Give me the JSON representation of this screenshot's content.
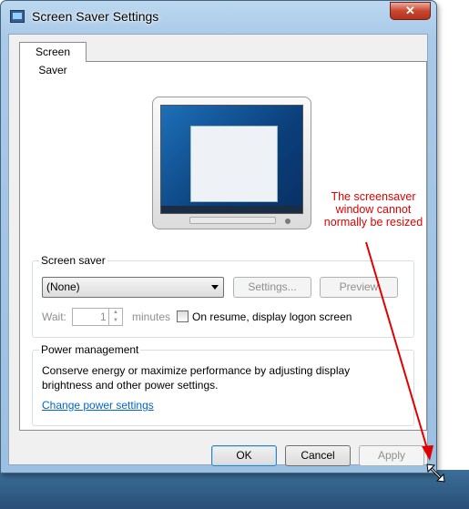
{
  "window": {
    "title": "Screen Saver Settings",
    "close_label": "✕"
  },
  "tabs": [
    {
      "label": "Screen Saver"
    }
  ],
  "screen_saver": {
    "group_label": "Screen saver",
    "selected": "(None)",
    "settings_label": "Settings...",
    "preview_label": "Preview",
    "wait_label": "Wait:",
    "wait_value": "1",
    "minutes_label": "minutes",
    "resume_label": "On resume, display logon screen",
    "resume_checked": false
  },
  "power": {
    "group_label": "Power management",
    "description": "Conserve energy or maximize performance by adjusting display brightness and other power settings.",
    "link_label": "Change power settings"
  },
  "footer": {
    "ok_label": "OK",
    "cancel_label": "Cancel",
    "apply_label": "Apply"
  },
  "annotation": {
    "text": "The screensaver window cannot normally be resized",
    "color": "#e00000"
  }
}
